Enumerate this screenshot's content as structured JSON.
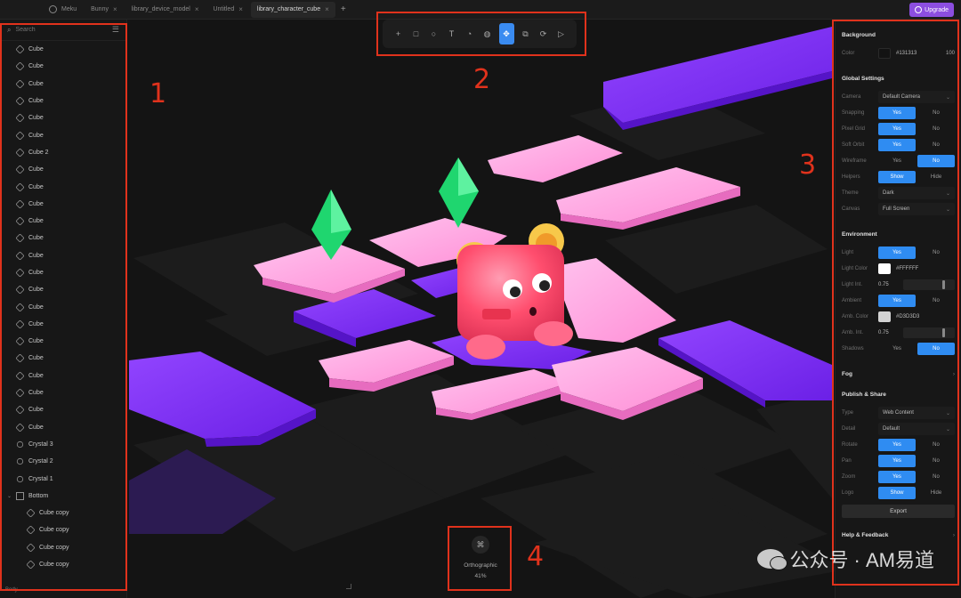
{
  "tabs": [
    {
      "label": "Meku",
      "active": false,
      "home": true
    },
    {
      "label": "Bunny",
      "active": false
    },
    {
      "label": "library_device_model",
      "active": false
    },
    {
      "label": "Untitled",
      "active": false
    },
    {
      "label": "library_character_cube",
      "active": true
    }
  ],
  "upgrade_label": "Upgrade",
  "search": {
    "placeholder": "Search"
  },
  "layers": [
    {
      "label": "Cube",
      "icon": "cube-icon"
    },
    {
      "label": "Cube",
      "icon": "cube-icon"
    },
    {
      "label": "Cube",
      "icon": "cube-icon"
    },
    {
      "label": "Cube",
      "icon": "cube-icon"
    },
    {
      "label": "Cube",
      "icon": "cube-icon"
    },
    {
      "label": "Cube",
      "icon": "cube-icon"
    },
    {
      "label": "Cube 2",
      "icon": "cube-icon"
    },
    {
      "label": "Cube",
      "icon": "cube-icon"
    },
    {
      "label": "Cube",
      "icon": "cube-icon"
    },
    {
      "label": "Cube",
      "icon": "cube-icon"
    },
    {
      "label": "Cube",
      "icon": "cube-icon"
    },
    {
      "label": "Cube",
      "icon": "cube-icon"
    },
    {
      "label": "Cube",
      "icon": "cube-icon"
    },
    {
      "label": "Cube",
      "icon": "cube-icon"
    },
    {
      "label": "Cube",
      "icon": "cube-icon"
    },
    {
      "label": "Cube",
      "icon": "cube-icon"
    },
    {
      "label": "Cube",
      "icon": "cube-icon"
    },
    {
      "label": "Cube",
      "icon": "cube-icon"
    },
    {
      "label": "Cube",
      "icon": "cube-icon"
    },
    {
      "label": "Cube",
      "icon": "cube-icon"
    },
    {
      "label": "Cube",
      "icon": "cube-icon"
    },
    {
      "label": "Cube",
      "icon": "cube-icon"
    },
    {
      "label": "Cube",
      "icon": "cube-icon"
    },
    {
      "label": "Crystal 3",
      "icon": "gem-icon"
    },
    {
      "label": "Crystal 2",
      "icon": "gem-icon"
    },
    {
      "label": "Crystal 1",
      "icon": "gem-icon"
    },
    {
      "label": "Bottom",
      "icon": "group-icon",
      "expanded": true
    },
    {
      "label": "Cube copy",
      "icon": "cube-icon",
      "child": true
    },
    {
      "label": "Cube copy",
      "icon": "cube-icon",
      "child": true
    },
    {
      "label": "Cube copy",
      "icon": "cube-icon",
      "child": true
    },
    {
      "label": "Cube copy",
      "icon": "cube-icon",
      "child": true
    }
  ],
  "left_footer": "Body",
  "toolbar": [
    "plus-icon",
    "square-icon",
    "circle-icon",
    "text-icon",
    "shape-icon",
    "sphere-icon",
    "move-icon",
    "scale-icon",
    "rotate-icon",
    "play-icon"
  ],
  "toolbar_active": "move-icon",
  "inspector": {
    "background": {
      "title": "Background",
      "color_label": "Color",
      "color_hex": "#131313",
      "opacity": "100",
      "color": "#131313"
    },
    "global": {
      "title": "Global Settings",
      "camera_label": "Camera",
      "camera_value": "Default Camera",
      "snapping_label": "Snapping",
      "pixel_grid_label": "Pixel Grid",
      "soft_orbit_label": "Soft Orbit",
      "wireframe_label": "Wireframe",
      "helpers_label": "Helpers",
      "theme_label": "Theme",
      "theme_value": "Dark",
      "canvas_label": "Canvas",
      "canvas_value": "Full Screen"
    },
    "environment": {
      "title": "Environment",
      "light_label": "Light",
      "light_color_label": "Light Color",
      "light_color_hex": "#FFFFFF",
      "light_color": "#ffffff",
      "light_int_label": "Light Int.",
      "light_int_value": "0.75",
      "ambient_label": "Ambient",
      "amb_color_label": "Amb. Color",
      "amb_color_hex": "#D3D3D3",
      "amb_color": "#d3d3d3",
      "amb_int_label": "Amb. Int.",
      "amb_int_value": "0.75",
      "shadows_label": "Shadows"
    },
    "fog_title": "Fog",
    "publish": {
      "title": "Publish & Share",
      "type_label": "Type",
      "type_value": "Web Content",
      "detail_label": "Detail",
      "detail_value": "Default",
      "rotate_label": "Rotate",
      "pan_label": "Pan",
      "zoom_label": "Zoom",
      "logo_label": "Logo",
      "export_label": "Export"
    },
    "help_title": "Help & Feedback",
    "yes": "Yes",
    "no": "No",
    "show": "Show",
    "hide": "Hide"
  },
  "view": {
    "mode": "Orthographic",
    "zoom": "41%"
  },
  "annotations": [
    "1",
    "2",
    "3",
    "4"
  ],
  "watermark": "公众号 · AM易道",
  "colors": {
    "accent": "#2f8cf2",
    "upgrade": "#8c4ee0",
    "annotation": "#e0321c",
    "tile_pink": "#ff9fe0",
    "tile_purple": "#7b2cf0",
    "crystal": "#1fd66f",
    "character": "#ff4e6e"
  }
}
